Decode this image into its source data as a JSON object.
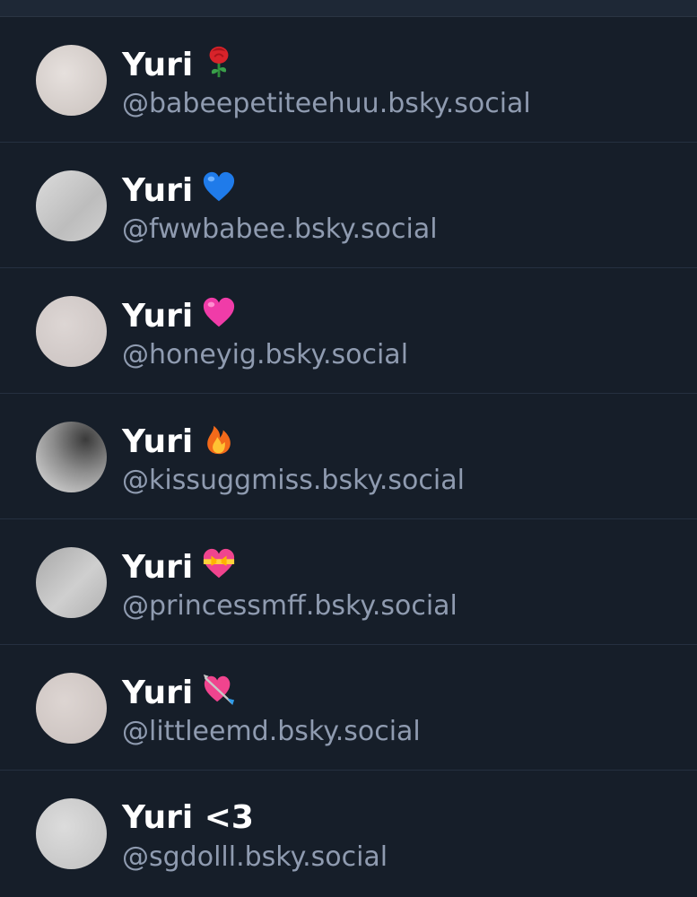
{
  "accounts": [
    {
      "name": "Yuri",
      "emoji": "rose-icon",
      "handle": "@babeepetiteehuu.bsky.social",
      "avatar_color": "#d8d0cc"
    },
    {
      "name": "Yuri",
      "emoji": "blue-heart-icon",
      "handle": "@fwwbabee.bsky.social",
      "avatar_color": "#cfcfcf"
    },
    {
      "name": "Yuri",
      "emoji": "pink-heart-icon",
      "handle": "@honeyig.bsky.social",
      "avatar_color": "#d6cecc"
    },
    {
      "name": "Yuri",
      "emoji": "fire-icon",
      "handle": "@kissuggmiss.bsky.social",
      "avatar_color": "#a9a9a9"
    },
    {
      "name": "Yuri",
      "emoji": "heart-with-ribbon-icon",
      "handle": "@princessmff.bsky.social",
      "avatar_color": "#b8b8b8"
    },
    {
      "name": "Yuri",
      "emoji": "heart-with-arrow-icon",
      "handle": "@littleemd.bsky.social",
      "avatar_color": "#d5cdca"
    },
    {
      "name": "Yuri <3",
      "emoji": "",
      "handle": "@sgdolll.bsky.social",
      "avatar_color": "#cdcdcd"
    }
  ]
}
